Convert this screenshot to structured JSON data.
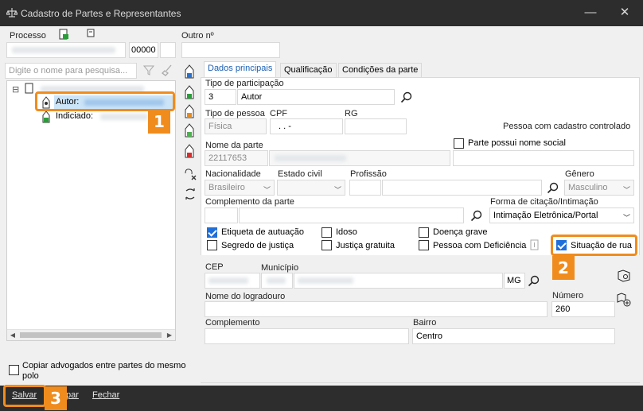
{
  "window": {
    "title": "Cadastro de Partes e Representantes",
    "minimize": "—",
    "close": "✕"
  },
  "top": {
    "processo_label": "Processo",
    "processo_suffix": "00000",
    "outro_label": "Outro nº",
    "outro_value": ""
  },
  "left": {
    "search_placeholder": "Digite o nome para pesquisa...",
    "tree": {
      "expander": "⊟",
      "item1_label": "Autor:",
      "item2_label": "Indiciado:"
    },
    "copy_checkbox_label": "Copiar advogados entre partes do mesmo polo",
    "copy_checked": false
  },
  "tabs": [
    {
      "label": "Dados principais",
      "active": true
    },
    {
      "label": "Qualificação",
      "active": false
    },
    {
      "label": "Condições da parte",
      "active": false
    }
  ],
  "form": {
    "tipo_participacao_label": "Tipo de participação",
    "tipo_participacao_code": "3",
    "tipo_participacao_value": "Autor",
    "tipo_pessoa_label": "Tipo de pessoa",
    "tipo_pessoa_value": "Física",
    "cpf_label": "CPF",
    "cpf_value": ".  .  -",
    "rg_label": "RG",
    "cadastro_controlado": "Pessoa com cadastro controlado",
    "nome_parte_label": "Nome da parte",
    "nome_parte_code": "22117653",
    "nome_social_label": "Parte possui nome social",
    "nacionalidade_label": "Nacionalidade",
    "nacionalidade_value": "Brasileiro",
    "estado_civil_label": "Estado civil",
    "profissao_label": "Profissão",
    "genero_label": "Gênero",
    "genero_value": "Masculino",
    "complemento_parte_label": "Complemento da parte",
    "forma_citacao_label": "Forma de citação/Intimação",
    "forma_citacao_value": "Intimação Eletrônica/Portal",
    "checks": {
      "etiqueta": {
        "label": "Etiqueta de autuação",
        "checked": true
      },
      "idoso": {
        "label": "Idoso",
        "checked": false
      },
      "doenca": {
        "label": "Doença grave",
        "checked": false
      },
      "segredo": {
        "label": "Segredo de justiça",
        "checked": false
      },
      "gratuita": {
        "label": "Justiça gratuita",
        "checked": false
      },
      "deficiencia": {
        "label": "Pessoa com Deficiência",
        "checked": false
      },
      "situacao_rua": {
        "label": "Situação de rua",
        "checked": true
      }
    },
    "cep_label": "CEP",
    "municipio_label": "Município",
    "uf_value": "MG",
    "logradouro_label": "Nome do logradouro",
    "numero_label": "Número",
    "numero_value": "260",
    "complemento_label": "Complemento",
    "bairro_label": "Bairro",
    "bairro_value": "Centro"
  },
  "buttons": {
    "salvar": "Salvar",
    "limpar": "par",
    "fechar": "Fechar"
  },
  "callouts": {
    "one": "1",
    "two": "2",
    "three": "3"
  },
  "colors": {
    "accent": "#f08c1e",
    "check_blue": "#1e6fd9",
    "title_bar": "#2d2d2d"
  }
}
